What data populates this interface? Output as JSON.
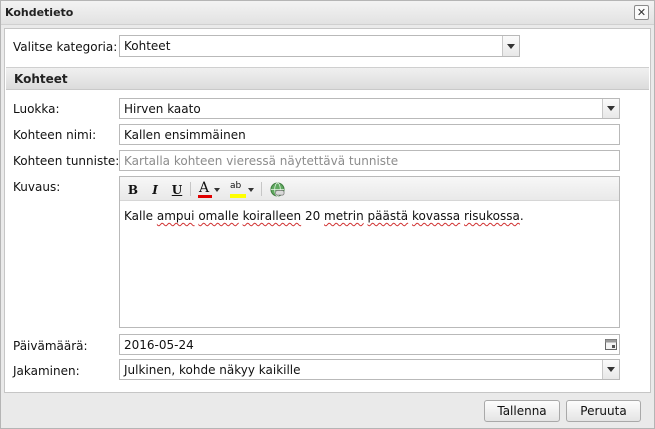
{
  "window": {
    "title": "Kohdetieto"
  },
  "category": {
    "label": "Valitse kategoria:",
    "value": "Kohteet"
  },
  "section": {
    "title": "Kohteet"
  },
  "form": {
    "class_label": "Luokka:",
    "class_value": "Hirven kaato",
    "name_label": "Kohteen nimi:",
    "name_value": "Kallen ensimmäinen",
    "id_label": "Kohteen tunniste:",
    "id_placeholder": "Kartalla kohteen vieressä näytettävä tunniste",
    "desc_label": "Kuvaus:",
    "desc_parts": [
      "Kalle ",
      "ampui",
      " ",
      "omalle",
      " ",
      "koiralleen",
      " 20 ",
      "metrin",
      " ",
      "päästä",
      " ",
      "kovassa",
      " ",
      "risukossa",
      "."
    ],
    "date_label": "Päivämäärä:",
    "date_value": "2016-05-24",
    "share_label": "Jakaminen:",
    "share_value": "Julkinen, kohde näkyy kaikille"
  },
  "toolbar": {
    "bold": "B",
    "italic": "I",
    "underline": "U",
    "font_color_glyph": "A",
    "highlight_glyph": "ab",
    "font_color_hex": "#e00000",
    "highlight_hex": "#ffff00",
    "icons": [
      "bold-icon",
      "italic-icon",
      "underline-icon",
      "font-color-icon",
      "highlight-icon",
      "link-icon"
    ]
  },
  "buttons": {
    "save": "Tallenna",
    "cancel": "Peruuta"
  }
}
